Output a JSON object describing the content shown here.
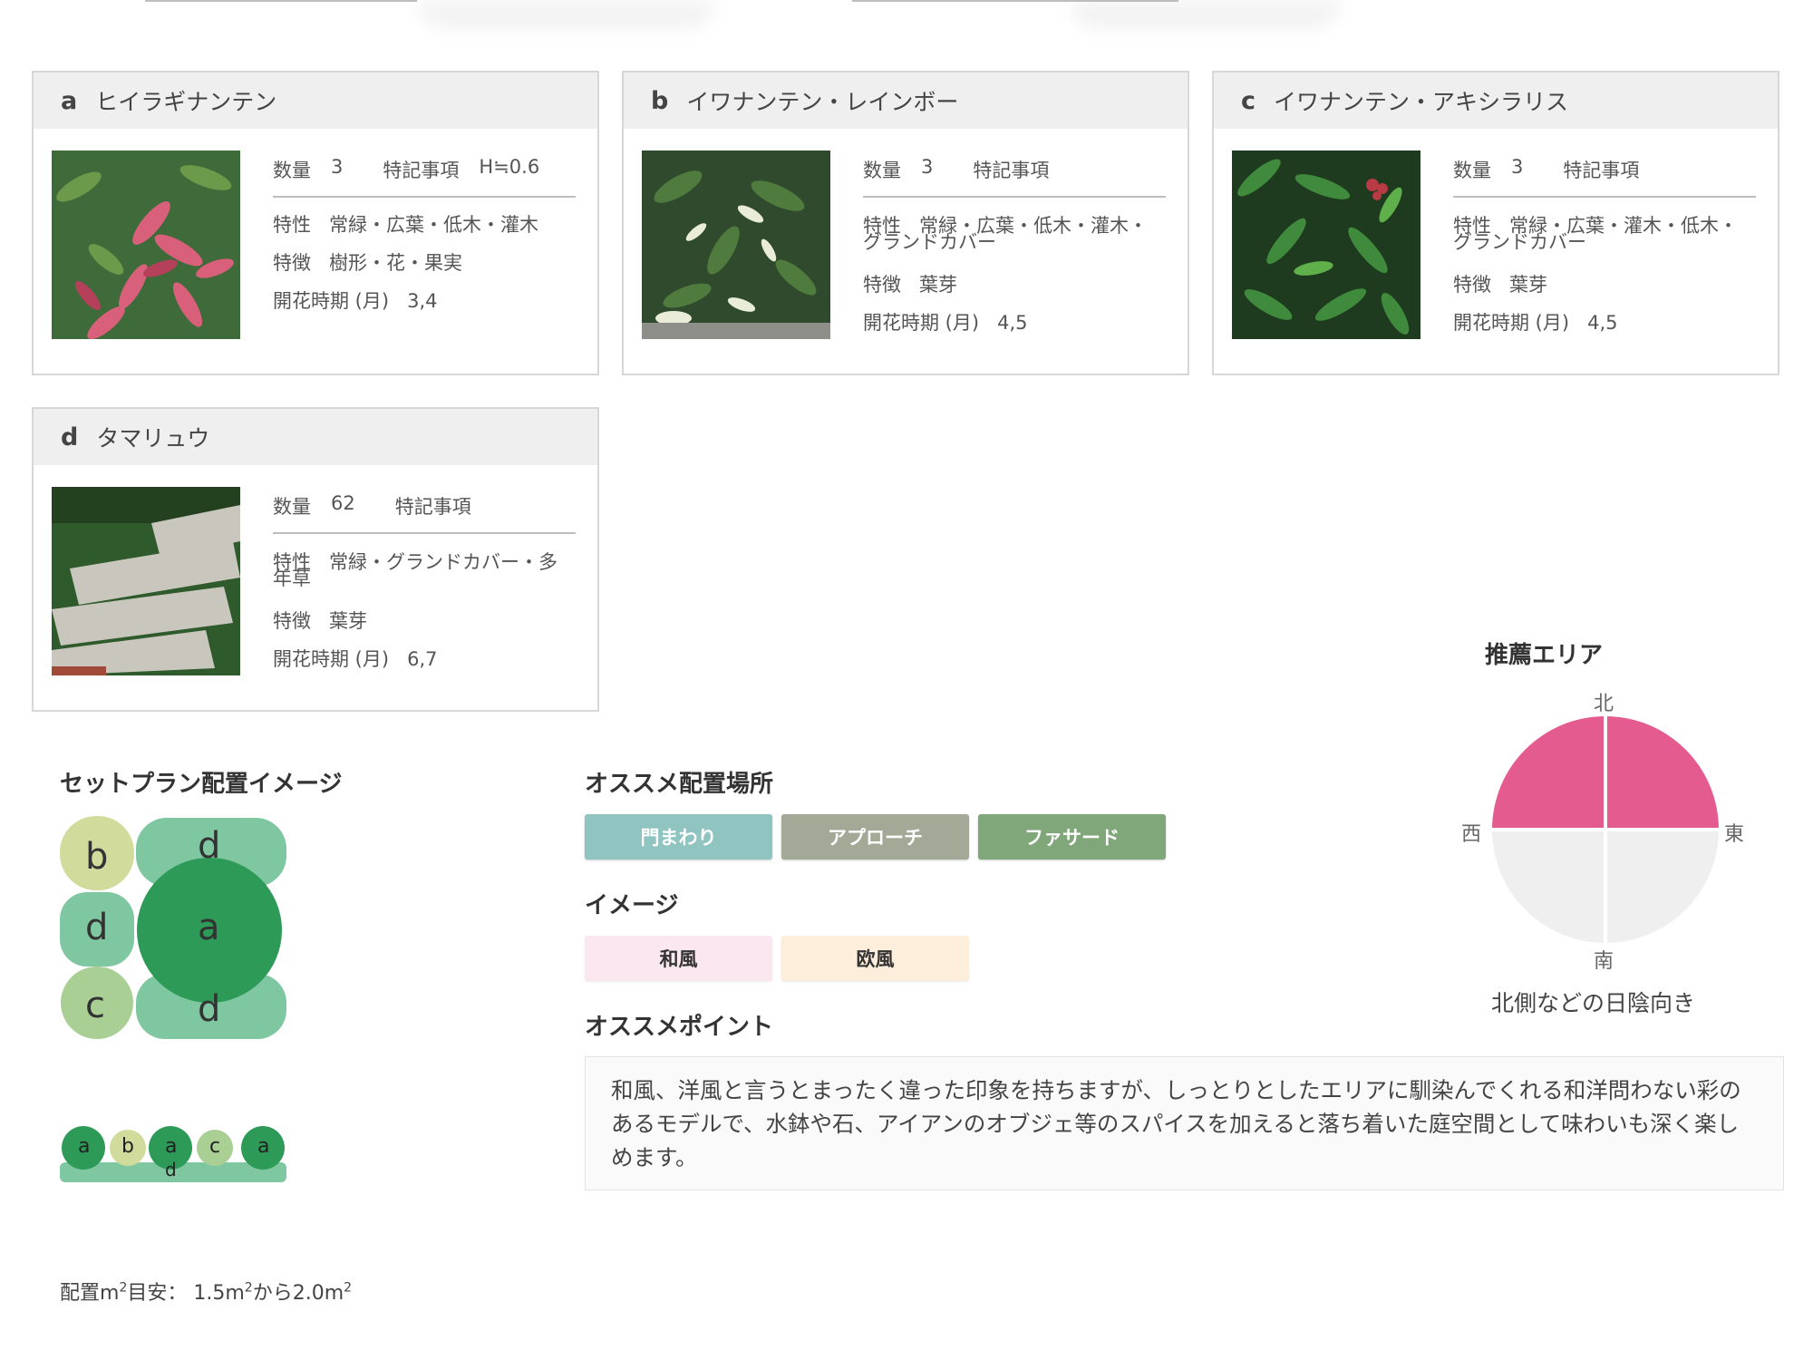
{
  "cards": [
    {
      "letter": "a",
      "name": "ヒイラギナンテン",
      "qty_label": "数量",
      "qty": "3",
      "note_label": "特記事項",
      "note": "H≒0.6",
      "trait_label": "特性",
      "trait": "常緑・広葉・低木・灌木",
      "feature_label": "特徴",
      "feature": "樹形・花・果実",
      "bloom_label": "開花時期 (月)",
      "bloom": "3,4",
      "photo_icon": "leaf-photo-reddish"
    },
    {
      "letter": "b",
      "name": "イワナンテン・レインボー",
      "qty_label": "数量",
      "qty": "3",
      "note_label": "特記事項",
      "note": "",
      "trait_label": "特性",
      "trait": "常緑・広葉・低木・灌木・グランドカバー",
      "feature_label": "特徴",
      "feature": "葉芽",
      "bloom_label": "開花時期 (月)",
      "bloom": "4,5",
      "photo_icon": "leaf-photo-variegated"
    },
    {
      "letter": "c",
      "name": "イワナンテン・アキシラリス",
      "qty_label": "数量",
      "qty": "3",
      "note_label": "特記事項",
      "note": "",
      "trait_label": "特性",
      "trait": "常緑・広葉・灌木・低木・グランドカバー",
      "feature_label": "特徴",
      "feature": "葉芽",
      "bloom_label": "開花時期 (月)",
      "bloom": "4,5",
      "photo_icon": "leaf-photo-green"
    },
    {
      "letter": "d",
      "name": "タマリュウ",
      "qty_label": "数量",
      "qty": "62",
      "note_label": "特記事項",
      "note": "",
      "trait_label": "特性",
      "trait": "常緑・グランドカバー・多年草",
      "feature_label": "特徴",
      "feature": "葉芽",
      "bloom_label": "開花時期 (月)",
      "bloom": "6,7",
      "photo_icon": "stepping-stone-photo"
    }
  ],
  "layout_title": "セットプラン配置イメージ",
  "layout_letters": {
    "top_left": "b",
    "top_right": "d",
    "mid_left": "d",
    "center": "a",
    "bottom_left": "c",
    "bottom_right": "d"
  },
  "side_letters": [
    "a",
    "b",
    "a",
    "c",
    "a",
    "d"
  ],
  "placement_title": "オススメ配置場所",
  "placement_tags": [
    {
      "label": "門まわり",
      "color": "#8fc4c1"
    },
    {
      "label": "アプローチ",
      "color": "#a4a897"
    },
    {
      "label": "ファサード",
      "color": "#80a779"
    }
  ],
  "image_title": "イメージ",
  "image_tags": [
    {
      "label": "和風",
      "color": "#fbe7ef"
    },
    {
      "label": "欧風",
      "color": "#fdeedb"
    }
  ],
  "point_title": "オススメポイント",
  "point_text": "和風、洋風と言うとまったく違った印象を持ちますが、しっとりとしたエリアに馴染んでくれる和洋問わない彩のあるモデルで、水鉢や石、アイアンのオブジェ等のスパイスを加えると落ち着いた庭空間として味わいも深く楽しめます。",
  "area": {
    "title": "推薦エリア",
    "north": "北",
    "south": "南",
    "east": "東",
    "west": "西",
    "highlight_color": "#e45c8f",
    "base_color": "#efefef",
    "highlighted": [
      "north-west",
      "north-east"
    ],
    "caption": "北側などの日陰向き"
  },
  "footer": {
    "prefix": "配置m",
    "mid": "目安： 1.5m",
    "mid2": "から2.0m",
    "sup": "2"
  }
}
